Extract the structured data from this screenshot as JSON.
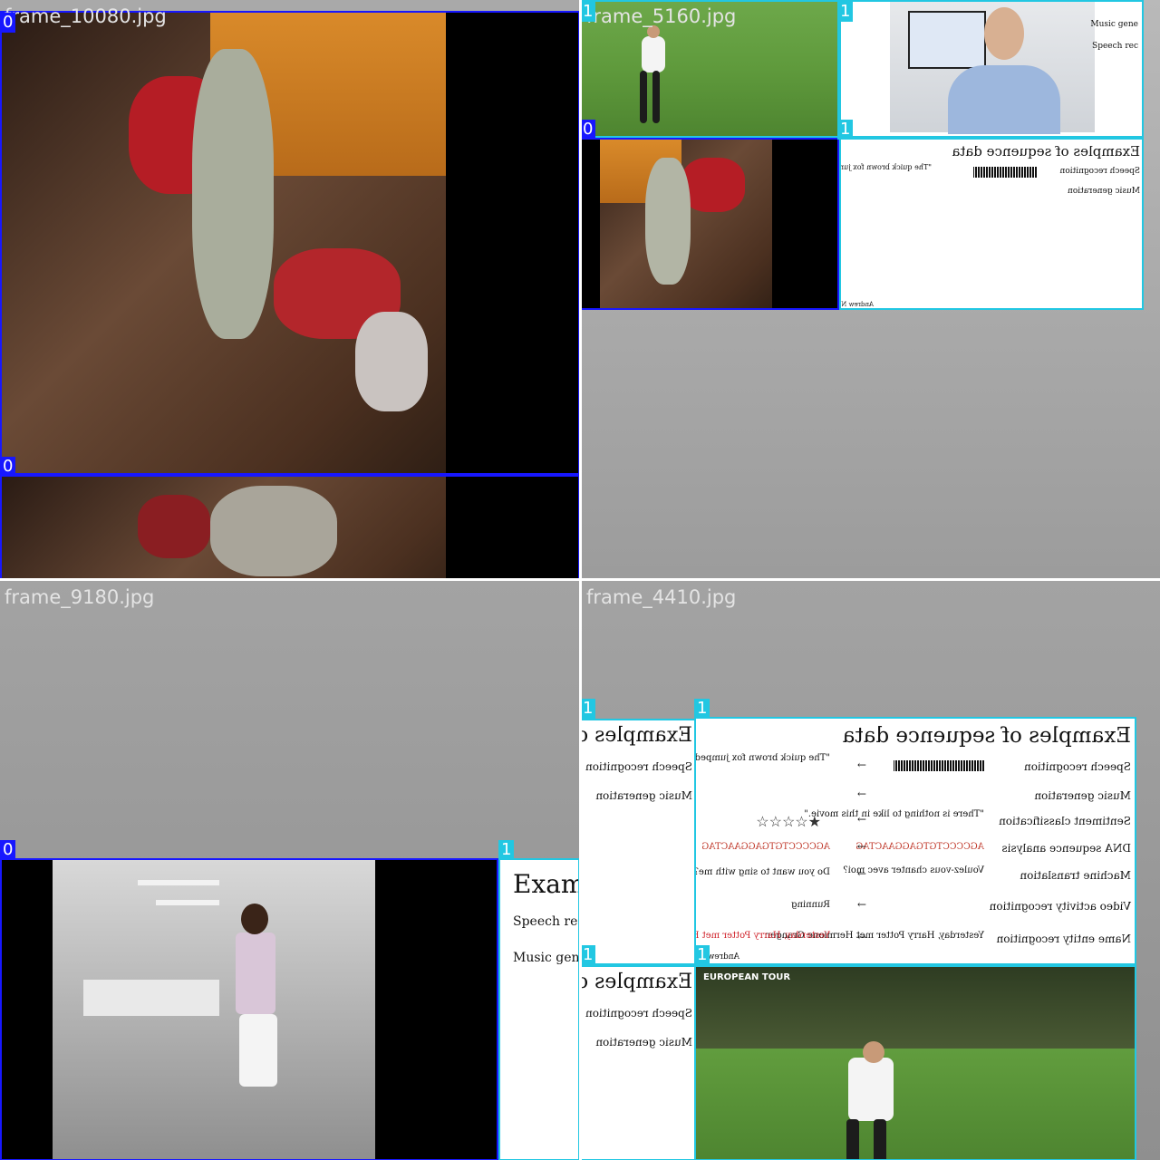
{
  "tiles": [
    {
      "name": "frame_10080.jpg"
    },
    {
      "name": "frame_5160.jpg"
    },
    {
      "name": "frame_9180.jpg"
    },
    {
      "name": "frame_4410.jpg"
    }
  ],
  "labels": {
    "zero": "0",
    "one": "1"
  },
  "slide": {
    "title": "Examples of sequence data",
    "title_partial": "Exam",
    "rows": [
      "Speech recognition",
      "Music generation",
      "Sentiment classification",
      "DNA sequence analysis",
      "Machine translation",
      "Video activity recognition",
      "Name entity recognition"
    ],
    "rows_partial": [
      "Speech rec",
      "Music gene"
    ],
    "outputs": [
      "\"The quick brown fox jumped over the lazy dog.\"",
      "",
      "\"There is nothing to like in this movie.\"",
      "AGCCCCTGTGAGGAACTAG",
      "Voulez-vous chanter avec moi?",
      "Yesterday, Harry Potter met Hermione Granger."
    ],
    "translations": [
      "Do you want to sing with me?",
      "Running",
      "Yesterday, Harry Potter met Hermione Granger"
    ],
    "dna_out": "AGCCCCTGTGAGGAACTAG",
    "author": "Andrew Ng"
  },
  "colors": {
    "class0": "#1717ff",
    "class1": "#22c7e2",
    "separator": "#ffffff"
  },
  "logo": {
    "text": "EUROPEAN TOUR"
  }
}
